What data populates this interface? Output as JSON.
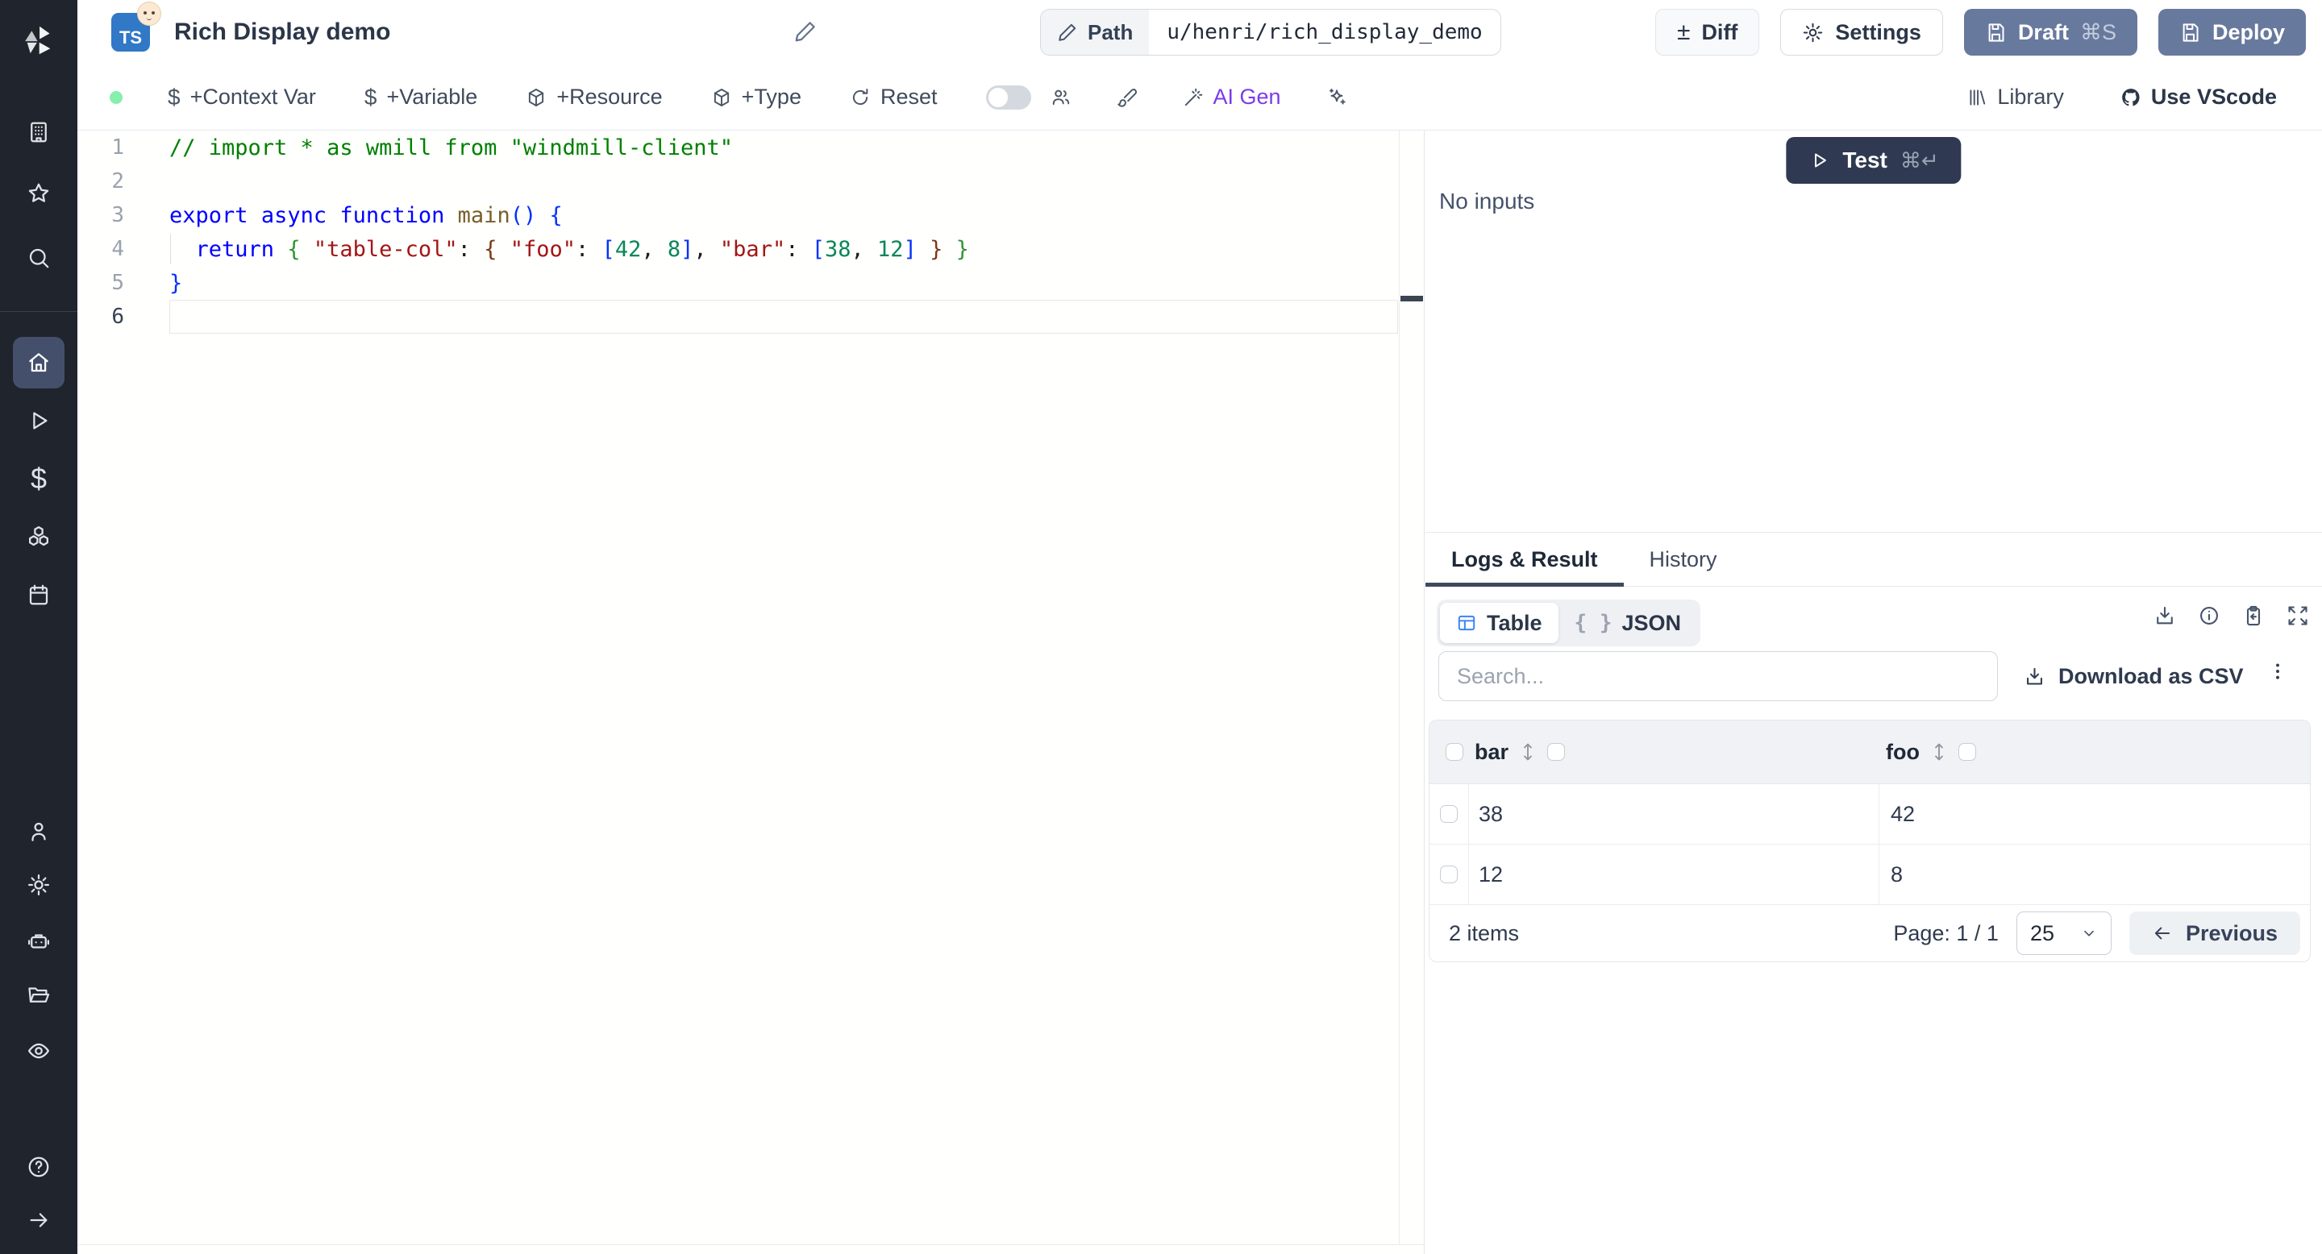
{
  "header": {
    "language_badge": "TS",
    "title": "Rich Display demo",
    "path_label": "Path",
    "path_value": "u/henri/rich_display_demo",
    "diff_label": "Diff",
    "settings_label": "Settings",
    "draft_label": "Draft",
    "draft_shortcut": "⌘S",
    "deploy_label": "Deploy",
    "diff_glyph": "±"
  },
  "toolbar": {
    "context_var": "+Context Var",
    "variable": "+Variable",
    "resource": "+Resource",
    "type": "+Type",
    "reset": "Reset",
    "ai_gen": "AI Gen",
    "library": "Library",
    "use_vscode": "Use VScode",
    "dollar_glyph": "$"
  },
  "sidebar": {
    "icons": [
      "windmill-logo",
      "building",
      "star",
      "search",
      "home",
      "play",
      "dollar",
      "boxes",
      "calendar",
      "user",
      "settings",
      "robot",
      "folder",
      "eye",
      "help",
      "collapse-arrow"
    ],
    "dollar_glyph": "$"
  },
  "editor": {
    "code": [
      {
        "n": "1",
        "tokens": [
          [
            "// import * as wmill from \"windmill-client\"",
            "tok-comment"
          ]
        ]
      },
      {
        "n": "2",
        "tokens": []
      },
      {
        "n": "3",
        "tokens": [
          [
            "export",
            "tok-kw"
          ],
          [
            " ",
            "tok-pl"
          ],
          [
            "async",
            "tok-kw"
          ],
          [
            " ",
            "tok-pl"
          ],
          [
            "function",
            "tok-kw"
          ],
          [
            " ",
            "tok-pl"
          ],
          [
            "main",
            "tok-fn"
          ],
          [
            "() {",
            "tok-br1"
          ]
        ]
      },
      {
        "n": "4",
        "guide": true,
        "tokens": [
          [
            "  ",
            "tok-pl"
          ],
          [
            "return",
            "tok-kw"
          ],
          [
            " ",
            "tok-pl"
          ],
          [
            "{",
            "tok-br2"
          ],
          [
            " ",
            "tok-pl"
          ],
          [
            "\"table-col\"",
            "tok-str"
          ],
          [
            ":",
            "tok-pl"
          ],
          [
            " ",
            "tok-pl"
          ],
          [
            "{",
            "tok-br3"
          ],
          [
            " ",
            "tok-pl"
          ],
          [
            "\"foo\"",
            "tok-str"
          ],
          [
            ":",
            "tok-pl"
          ],
          [
            " ",
            "tok-pl"
          ],
          [
            "[",
            "tok-br1"
          ],
          [
            "42",
            "tok-num"
          ],
          [
            ",",
            "tok-pl"
          ],
          [
            " ",
            "tok-pl"
          ],
          [
            "8",
            "tok-num"
          ],
          [
            "]",
            "tok-br1"
          ],
          [
            ",",
            "tok-pl"
          ],
          [
            " ",
            "tok-pl"
          ],
          [
            "\"bar\"",
            "tok-str"
          ],
          [
            ":",
            "tok-pl"
          ],
          [
            " ",
            "tok-pl"
          ],
          [
            "[",
            "tok-br1"
          ],
          [
            "38",
            "tok-num"
          ],
          [
            ",",
            "tok-pl"
          ],
          [
            " ",
            "tok-pl"
          ],
          [
            "12",
            "tok-num"
          ],
          [
            "]",
            "tok-br1"
          ],
          [
            " ",
            "tok-pl"
          ],
          [
            "}",
            "tok-br3"
          ],
          [
            " ",
            "tok-pl"
          ],
          [
            "}",
            "tok-br2"
          ]
        ]
      },
      {
        "n": "5",
        "tokens": [
          [
            "}",
            "tok-br1"
          ]
        ]
      },
      {
        "n": "6",
        "current": true,
        "tokens": []
      }
    ]
  },
  "run_panel": {
    "test_label": "Test",
    "test_shortcut": "⌘↵",
    "no_inputs": "No inputs"
  },
  "result_panel": {
    "tabs": [
      "Logs & Result",
      "History"
    ],
    "view_table": "Table",
    "view_json": "JSON",
    "json_braces": "{ }",
    "search_placeholder": "Search...",
    "download_csv": "Download as CSV"
  },
  "result_table": {
    "columns": [
      "bar",
      "foo"
    ],
    "rows": [
      {
        "bar": "38",
        "foo": "42"
      },
      {
        "bar": "12",
        "foo": "8"
      }
    ],
    "items_label": "2 items",
    "page_label": "Page: 1 / 1",
    "page_size": "25",
    "previous_label": "Previous"
  },
  "colors": {
    "sidebar_bg": "#20242c",
    "sidebar_active_bg": "#44506b",
    "slate_button": "#68799e",
    "test_button": "#2f3a52",
    "accent_purple": "#7c3aed",
    "green_status_dot": "#86efac",
    "ts_badge_blue": "#3178c6",
    "table_icon_blue": "#3b82f6",
    "active_tab_underline": "#3e4a5c"
  }
}
